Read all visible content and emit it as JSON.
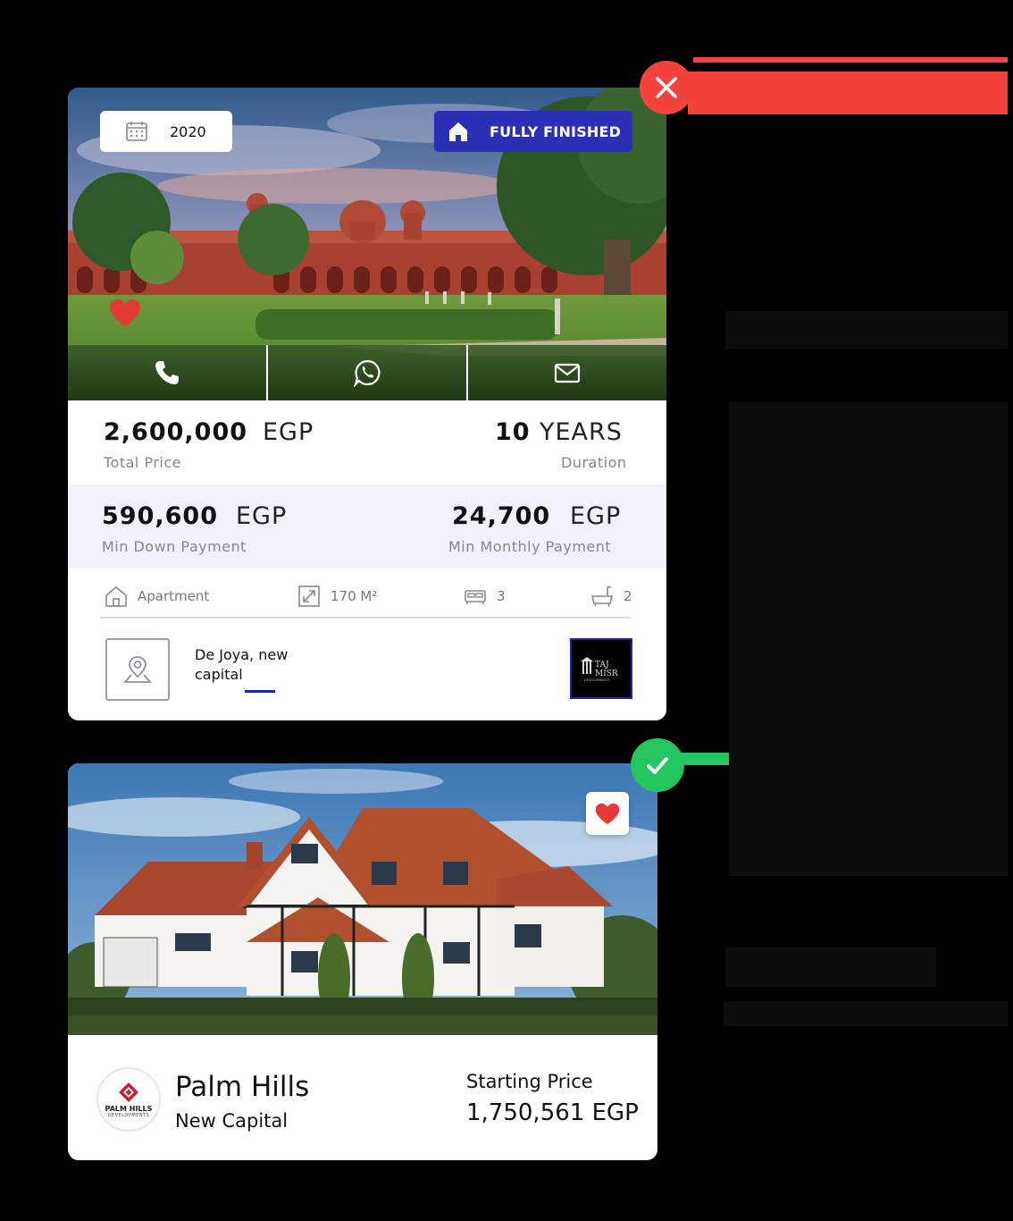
{
  "colors": {
    "reject": "#f2433d",
    "accept": "#22c55e",
    "brand_blue": "#2b2fb5",
    "favorite_red": "#e53935",
    "highlight_row": "#f0f1fb"
  },
  "status_badges": {
    "top_card": "close-icon",
    "bottom_card": "check-icon"
  },
  "card1": {
    "image": "mosque-courtyard-photo",
    "year_badge": {
      "icon": "calendar-icon",
      "text": "2020"
    },
    "finishing_badge": {
      "icon": "home-icon",
      "text": "FULLY FINISHED"
    },
    "favorite": {
      "icon": "heart-icon",
      "active": true
    },
    "contact": [
      {
        "icon": "phone-icon"
      },
      {
        "icon": "whatsapp-icon"
      },
      {
        "icon": "mail-icon"
      }
    ],
    "total_price": {
      "value": "2,600,000",
      "unit": "EGP",
      "label": "Total Price"
    },
    "duration": {
      "value": "10",
      "unit": "YEARS",
      "label": "Duration"
    },
    "down_payment": {
      "value": "590,600",
      "unit": "EGP",
      "label": "Min Down Payment"
    },
    "monthly_payment": {
      "value": "24,700",
      "unit": "EGP",
      "label": "Min Monthly Payment"
    },
    "specs": {
      "type": {
        "icon": "home-outline-icon",
        "text": "Apartment"
      },
      "area": {
        "icon": "expand-icon",
        "text": "170 M²"
      },
      "bedrooms": {
        "icon": "bed-icon",
        "text": "3"
      },
      "bathrooms": {
        "icon": "bathtub-icon",
        "text": "2"
      }
    },
    "location": {
      "icon": "map-pin-icon",
      "line1": "De Joya, new",
      "line2": "capital"
    },
    "developer_logo": {
      "line1": "TAJ",
      "line2": "MISR",
      "line3": "DEVELOPMENTS"
    }
  },
  "card2": {
    "image": "house-photo",
    "favorite": {
      "icon": "heart-icon",
      "active": true
    },
    "developer_logo": {
      "name": "PALM HILLS",
      "sub": "DEVELOPMENTS"
    },
    "project_name": "Palm Hills",
    "project_location": "New Capital",
    "starting_price_label": "Starting Price",
    "starting_price": "1,750,561 EGP"
  }
}
